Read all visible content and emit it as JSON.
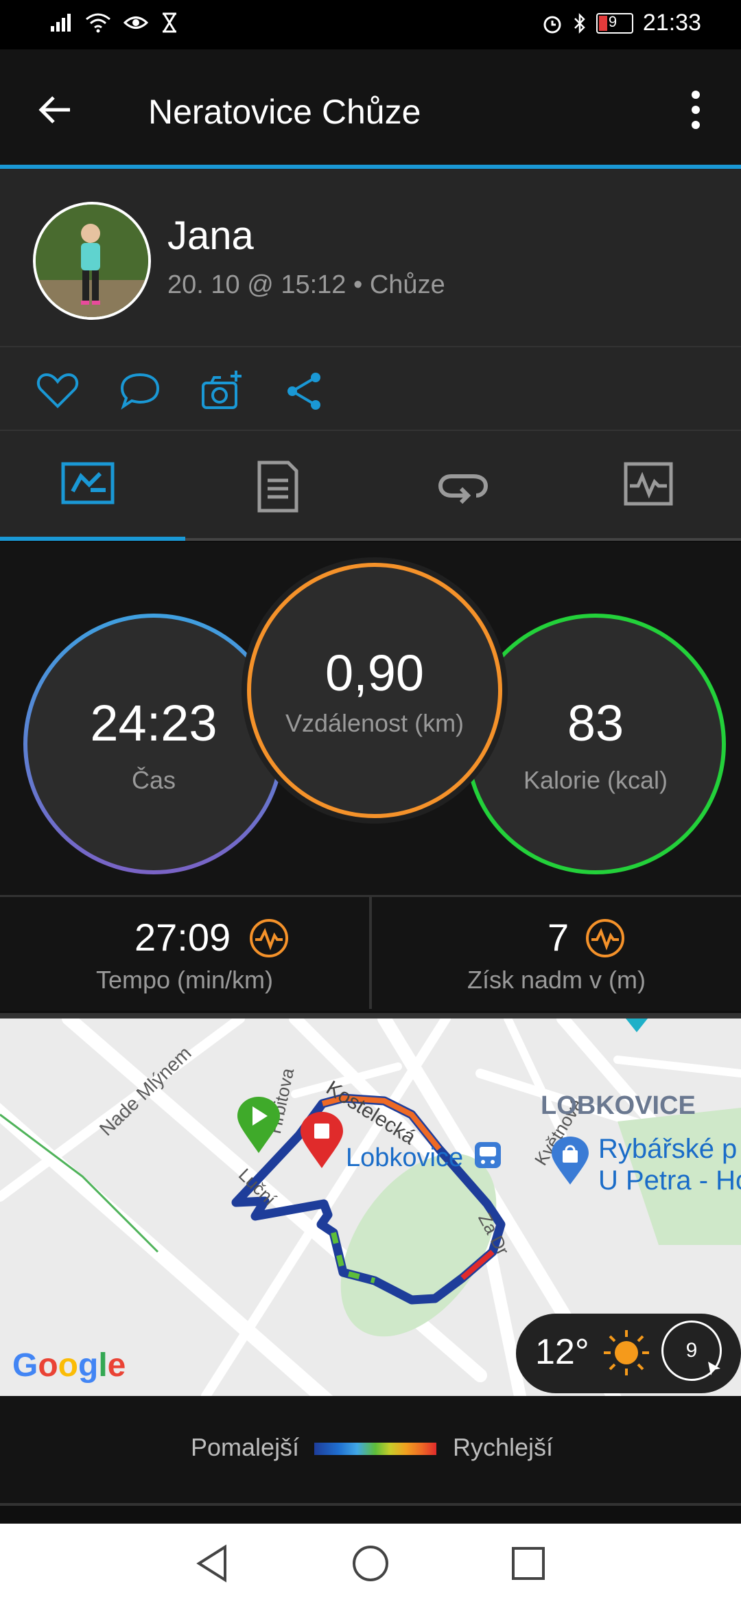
{
  "status_bar": {
    "battery_level": "9",
    "time": "21:33"
  },
  "app_bar": {
    "title": "Neratovice Chůze"
  },
  "profile": {
    "name": "Jana",
    "meta": "20. 10 @ 15:12 • Chůze"
  },
  "stats": {
    "time": {
      "value": "24:23",
      "label": "Čas"
    },
    "distance": {
      "value": "0,90",
      "label": "Vzdálenost (km)"
    },
    "calories": {
      "value": "83",
      "label": "Kalorie (kcal)"
    }
  },
  "metrics": {
    "pace": {
      "value": "27:09",
      "label": "Tempo (min/km)"
    },
    "elevation": {
      "value": "7",
      "label": "Získ nadm v (m)"
    }
  },
  "map": {
    "area_label": "LOBKOVICE",
    "streets": [
      "Nade Mlýnem",
      "Kostelecká",
      "Hřbitova",
      "Luční",
      "Květnová",
      "Za Dr"
    ],
    "place_label": "Lobkovice",
    "poi_line1": "Rybářské p",
    "poi_line2": "U Petra - Ho",
    "logo": "Google",
    "weather_temp": "12°",
    "wind_speed": "9"
  },
  "legend": {
    "slower": "Pomalejší",
    "faster": "Rychlejší"
  },
  "colors": {
    "accent": "#1a98d5",
    "time_ring": "#3f8fdb",
    "distance_ring": "#f5922a",
    "calories_ring": "#23d13a",
    "route": "#1e4aa8"
  }
}
